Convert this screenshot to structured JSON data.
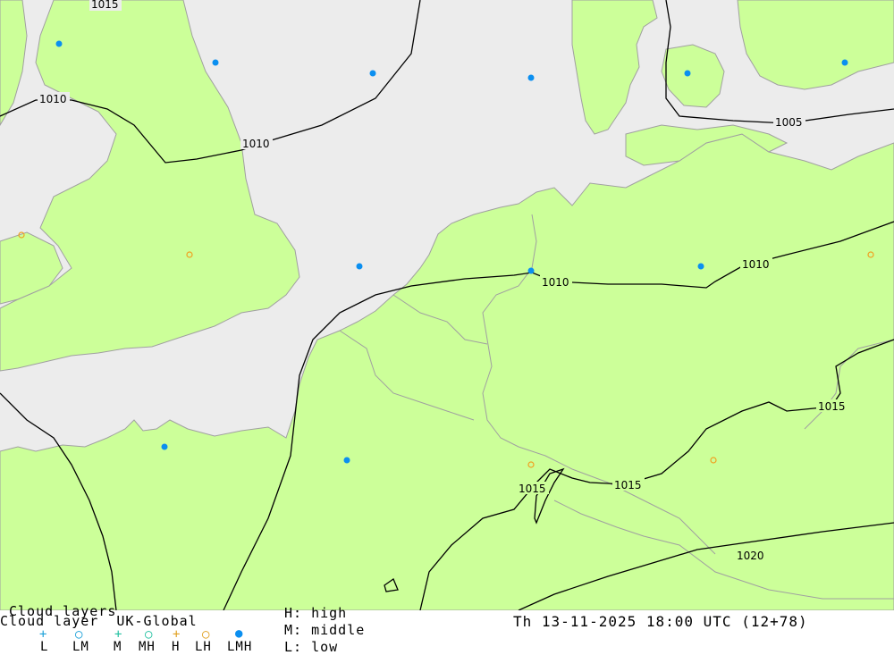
{
  "map": {
    "colors": {
      "sea": "#ececec",
      "land": "#ccff99",
      "coast": "#a0a0a0",
      "isobar": "#000000",
      "marker_blue": "#0b8ff0",
      "marker_orange": "#f0a020"
    },
    "isobar_labels": [
      "1015",
      "1010",
      "1010",
      "1005",
      "1010",
      "1010",
      "1015",
      "1015",
      "1015",
      "1020"
    ]
  },
  "footer": {
    "title": "Cloud layers",
    "model_label": "Cloud layer  UK-Global",
    "legend": {
      "items": [
        {
          "label": "L",
          "symbol": "+",
          "color": "#1aa0d8",
          "icon": "cross-icon"
        },
        {
          "label": "LM",
          "symbol": "○",
          "color": "#1aa0d8",
          "icon": "ring-icon"
        },
        {
          "label": "M",
          "symbol": "+",
          "color": "#20c0a0",
          "icon": "cross-icon"
        },
        {
          "label": "MH",
          "symbol": "○",
          "color": "#20c0a0",
          "icon": "ring-icon"
        },
        {
          "label": "H",
          "symbol": "+",
          "color": "#e0a020",
          "icon": "cross-icon"
        },
        {
          "label": "LH",
          "symbol": "○",
          "color": "#e0a020",
          "icon": "ring-icon"
        },
        {
          "label": "LMH",
          "symbol": "●",
          "color": "#0b8ff0",
          "icon": "dot-icon"
        }
      ]
    },
    "key": {
      "high": "H: high",
      "middle": "M: middle",
      "low": "L: low"
    },
    "datetime": "Th 13-11-2025 18:00 UTC (12+78)"
  }
}
